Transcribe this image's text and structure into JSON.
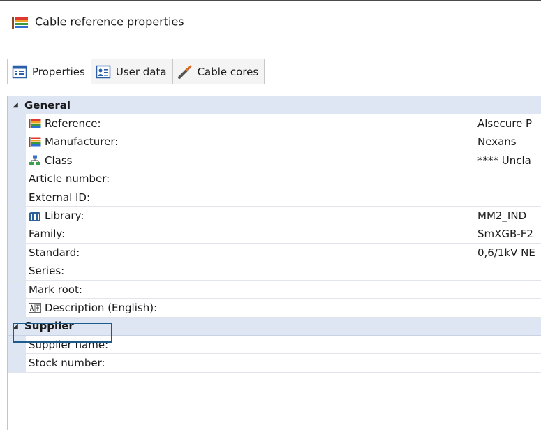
{
  "window": {
    "title": "Cable reference properties"
  },
  "tabs": [
    {
      "label": "Properties",
      "icon": "properties-icon",
      "active": true
    },
    {
      "label": "User data",
      "icon": "user-data-icon",
      "active": false
    },
    {
      "label": "Cable cores",
      "icon": "cable-cores-icon",
      "active": false
    }
  ],
  "general": {
    "label": "General",
    "rows": [
      {
        "name": "Reference:",
        "value": "Alsecure P",
        "icon": "cable-icon"
      },
      {
        "name": "Manufacturer:",
        "value": "Nexans",
        "icon": "cable-icon"
      },
      {
        "name": "Class",
        "value": "**** Uncla",
        "icon": "class-icon"
      },
      {
        "name": "Article number:",
        "value": ""
      },
      {
        "name": "External ID:",
        "value": ""
      },
      {
        "name": "Library:",
        "value": "MM2_IND",
        "icon": "library-icon"
      },
      {
        "name": "Family:",
        "value": "SmXGB-F2",
        "icon": ""
      },
      {
        "name": "Standard:",
        "value": "0,6/1kV NE",
        "icon": ""
      },
      {
        "name": "Series:",
        "value": ""
      },
      {
        "name": "Mark root:",
        "value": ""
      },
      {
        "name": "Description (English):",
        "value": "",
        "icon": "translate-icon"
      }
    ]
  },
  "supplier": {
    "label": "Supplier",
    "rows": [
      {
        "name": "Supplier name:",
        "value": ""
      },
      {
        "name": "Stock number:",
        "value": ""
      }
    ]
  },
  "colors": {
    "category_bg": "#dde6f2",
    "highlight_border": "#1d5b8e"
  }
}
